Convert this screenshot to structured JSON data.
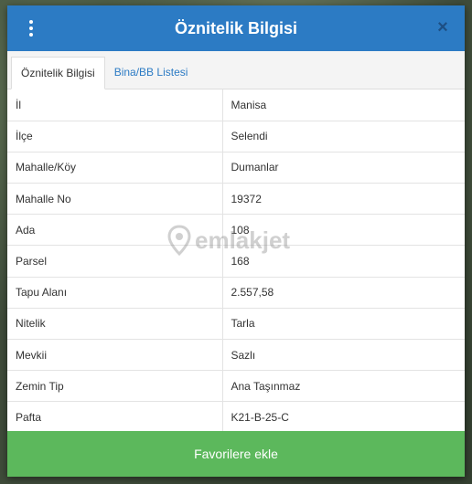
{
  "header": {
    "title": "Öznitelik Bilgisi",
    "close_glyph": "×"
  },
  "tabs": [
    {
      "label": "Öznitelik Bilgisi",
      "active": true
    },
    {
      "label": "Bina/BB Listesi",
      "active": false
    }
  ],
  "attributes": [
    {
      "key": "İl",
      "value": "Manisa"
    },
    {
      "key": "İlçe",
      "value": "Selendi"
    },
    {
      "key": "Mahalle/Köy",
      "value": "Dumanlar"
    },
    {
      "key": "Mahalle No",
      "value": "19372"
    },
    {
      "key": "Ada",
      "value": "108"
    },
    {
      "key": "Parsel",
      "value": "168"
    },
    {
      "key": "Tapu Alanı",
      "value": "2.557,58"
    },
    {
      "key": "Nitelik",
      "value": "Tarla"
    },
    {
      "key": "Mevkii",
      "value": "Sazlı"
    },
    {
      "key": "Zemin Tip",
      "value": "Ana Taşınmaz"
    },
    {
      "key": "Pafta",
      "value": "K21-B-25-C"
    }
  ],
  "watermark": "emlakjet",
  "footer": {
    "button_label": "Favorilere ekle"
  },
  "colors": {
    "header": "#2c7bc4",
    "button": "#5cb85c"
  }
}
